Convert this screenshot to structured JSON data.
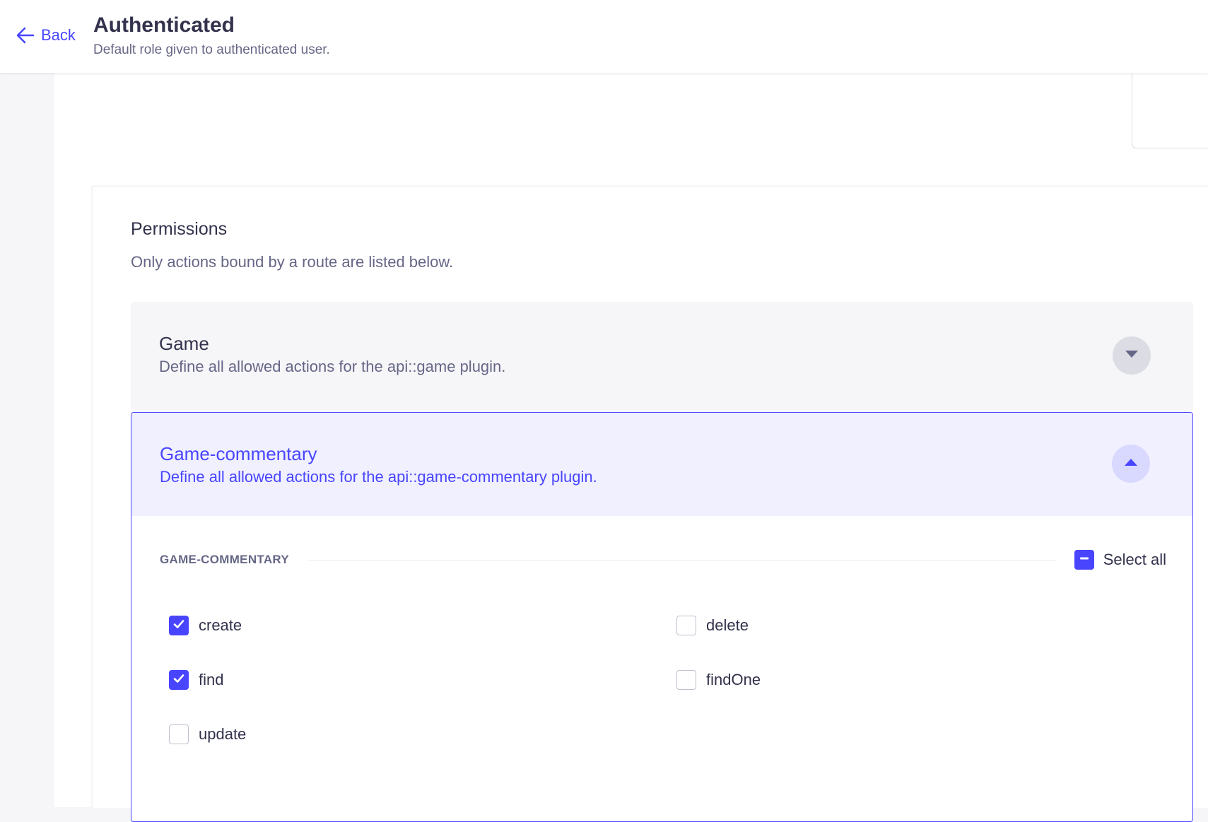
{
  "header": {
    "back_label": "Back",
    "title": "Authenticated",
    "subtitle": "Default role given to authenticated user."
  },
  "permissions": {
    "title": "Permissions",
    "subtitle": "Only actions bound by a route are listed below.",
    "accordions": [
      {
        "name": "Game",
        "description": "Define all allowed actions for the api::game plugin.",
        "expanded": false
      },
      {
        "name": "Game-commentary",
        "description": "Define all allowed actions for the api::game-commentary plugin.",
        "expanded": true,
        "group": {
          "label": "GAME-COMMENTARY",
          "select_all_label": "Select all",
          "select_all_state": "indeterminate",
          "actions": [
            {
              "label": "create",
              "checked": true
            },
            {
              "label": "delete",
              "checked": false
            },
            {
              "label": "find",
              "checked": true
            },
            {
              "label": "findOne",
              "checked": false
            },
            {
              "label": "update",
              "checked": false
            }
          ]
        }
      }
    ]
  },
  "colors": {
    "primary": "#4945ff",
    "primary_light": "#f0f0ff",
    "neutral_text": "#32324d",
    "muted_text": "#666687",
    "border": "#c0c0cf"
  },
  "icons": {
    "back": "arrow-left-icon",
    "collapse_closed": "caret-down-icon",
    "collapse_open": "caret-up-icon",
    "checked": "check-icon",
    "indeterminate": "minus-icon"
  }
}
